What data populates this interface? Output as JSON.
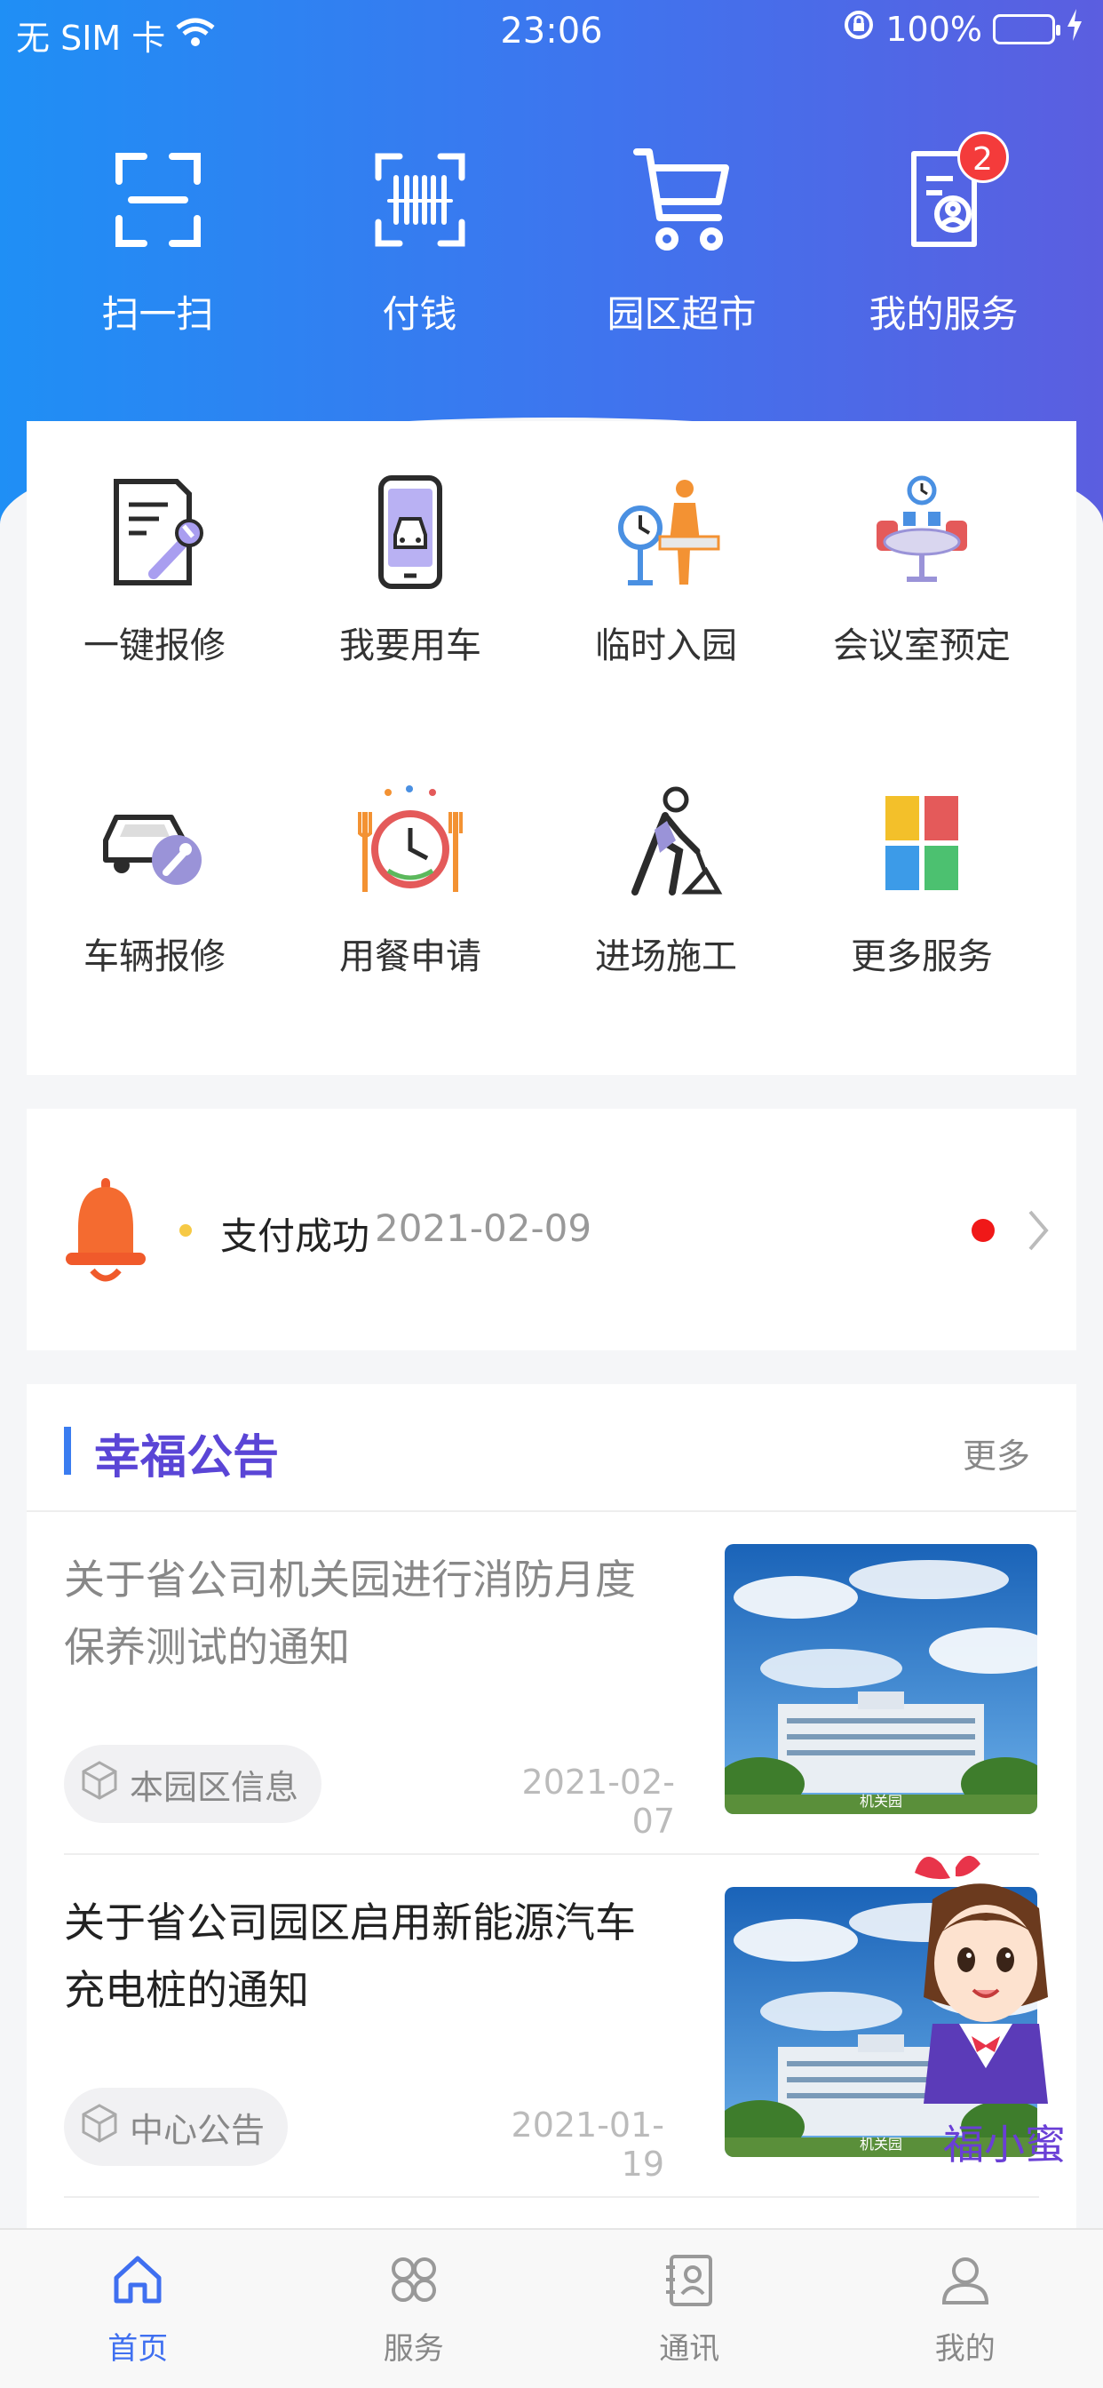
{
  "status_bar": {
    "carrier": "无 SIM 卡",
    "time": "23:06",
    "battery": "100%"
  },
  "quick_actions": [
    {
      "label": "扫一扫",
      "icon": "scan-icon"
    },
    {
      "label": "付钱",
      "icon": "barcode-icon"
    },
    {
      "label": "园区超市",
      "icon": "cart-icon"
    },
    {
      "label": "我的服务",
      "icon": "my-service-icon",
      "badge": "2"
    }
  ],
  "services": [
    {
      "label": "一键报修",
      "icon": "repair-doc-icon"
    },
    {
      "label": "我要用车",
      "icon": "car-phone-icon"
    },
    {
      "label": "临时入园",
      "icon": "visitor-entry-icon"
    },
    {
      "label": "会议室预定",
      "icon": "meeting-room-icon"
    },
    {
      "label": "车辆报修",
      "icon": "car-repair-icon"
    },
    {
      "label": "用餐申请",
      "icon": "dining-clock-icon"
    },
    {
      "label": "进场施工",
      "icon": "construction-worker-icon"
    },
    {
      "label": "更多服务",
      "icon": "more-grid-icon"
    }
  ],
  "notice": {
    "text": "支付成功",
    "date": "2021-02-09"
  },
  "announcements": {
    "title": "幸福公告",
    "more": "更多",
    "items": [
      {
        "title": "关于省公司机关园进行消防月度保养测试的通知",
        "tag": "本园区信息",
        "date": "2021-02-07",
        "read": true,
        "image_caption": "机关园"
      },
      {
        "title": "关于省公司园区启用新能源汽车充电桩的通知",
        "tag": "中心公告",
        "date": "2021-01-19",
        "read": false,
        "image_caption": "机关园"
      }
    ]
  },
  "mascot": {
    "name": "福小蜜"
  },
  "tabs": [
    {
      "label": "首页",
      "icon": "home-icon",
      "active": true
    },
    {
      "label": "服务",
      "icon": "services-icon",
      "active": false
    },
    {
      "label": "通讯",
      "icon": "contacts-icon",
      "active": false
    },
    {
      "label": "我的",
      "icon": "profile-icon",
      "active": false
    }
  ],
  "colors": {
    "accent": "#3f6ff0",
    "title_purple": "#5a45d6",
    "badge_red": "#f43b3b"
  }
}
